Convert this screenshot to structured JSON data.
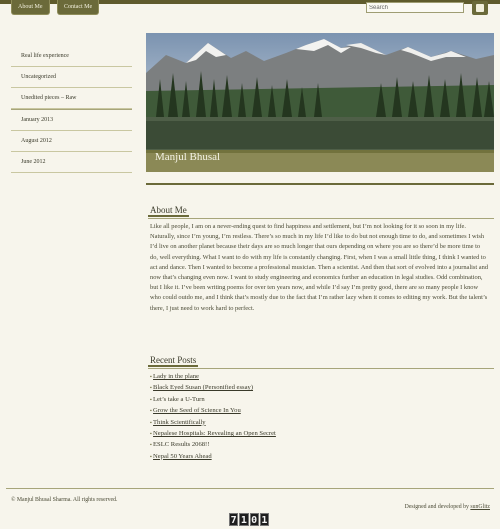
{
  "nav": {
    "tabs": [
      {
        "label": "About Me"
      },
      {
        "label": "Contact Me"
      }
    ]
  },
  "search": {
    "value": "Search"
  },
  "sidebar": {
    "items": [
      {
        "label": "Real life experience"
      },
      {
        "label": "Uncategorized"
      },
      {
        "label": "Unedited pieces – Raw"
      },
      {
        "label": "January 2013"
      },
      {
        "label": "August 2012"
      },
      {
        "label": "June 2012"
      }
    ]
  },
  "header": {
    "site_title": "Manjul Bhusal"
  },
  "about": {
    "heading": "About Me",
    "body": "Like all people, I am on a never-ending quest to find happiness and settlement, but I’m not looking for it so soon in my life. Naturally, since I’m young, I’m restless. There’s so much in my life I’d like to do but not enough time to do, and sometimes I wish I’d live on another planet because their days are so much longer that ours depending on where you are so there’d be more time to do, well everything. What I want to do with my life is constantly changing. First, when I was a small little thing, I think I wanted to act and dance. Then I wanted to become a professional musician. Then a scientist. And then that sort of evolved into a journalist and now that’s changing even now. I want to study engineering and economics further an education in legal studies. Odd combination, but I like it. I’ve been writing poems for over ten years now, and while I’d say I’m pretty good, there are so many people I know who could outdo me, and I think that’s mostly due to the fact that I’m rather lazy when it comes to editing my work. But the talent’s there, I just need to work hard to perfect."
  },
  "recent_posts": {
    "heading": "Recent Posts",
    "items": [
      {
        "label": "Lady in the plane",
        "link": true
      },
      {
        "label": "Black Eyed Susan (Personified essay)",
        "link": true
      },
      {
        "label": "Let’s take a U-Turn",
        "link": false
      },
      {
        "label": "Grow the Seed of Science In You",
        "link": true
      },
      {
        "label": "Think Scientifically",
        "link": true
      },
      {
        "label": "Nepalese Hospitals: Revealing an Open Secret",
        "link": true
      },
      {
        "label": "ESLC Results 2068!!",
        "link": false
      },
      {
        "label": "Nepal 50 Years Ahead",
        "link": true
      }
    ]
  },
  "footer": {
    "copyright": "© Manjul Bhusal Sharma. All rights reserved.",
    "credit_prefix": "Designed and developed by",
    "credit_link": "sunGlitz"
  },
  "counter": {
    "digits": [
      "7",
      "1",
      "0",
      "1"
    ]
  }
}
